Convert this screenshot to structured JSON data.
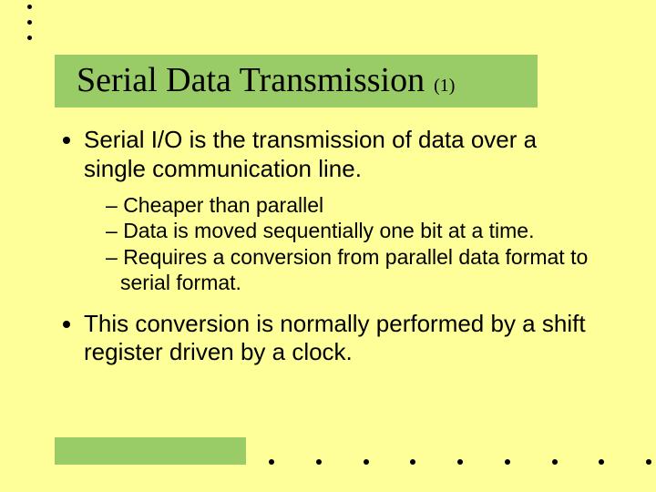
{
  "title": {
    "main": "Serial Data Transmission",
    "num": "(1)"
  },
  "bullets": [
    {
      "text": "Serial I/O is the transmission of data over a single communication line.",
      "sub": [
        "Cheaper than parallel",
        "Data is moved sequentially one bit at a time.",
        "Requires a conversion from parallel data format to serial format."
      ]
    },
    {
      "text": "This conversion is normally performed by a shift register driven by a clock.",
      "sub": []
    }
  ]
}
